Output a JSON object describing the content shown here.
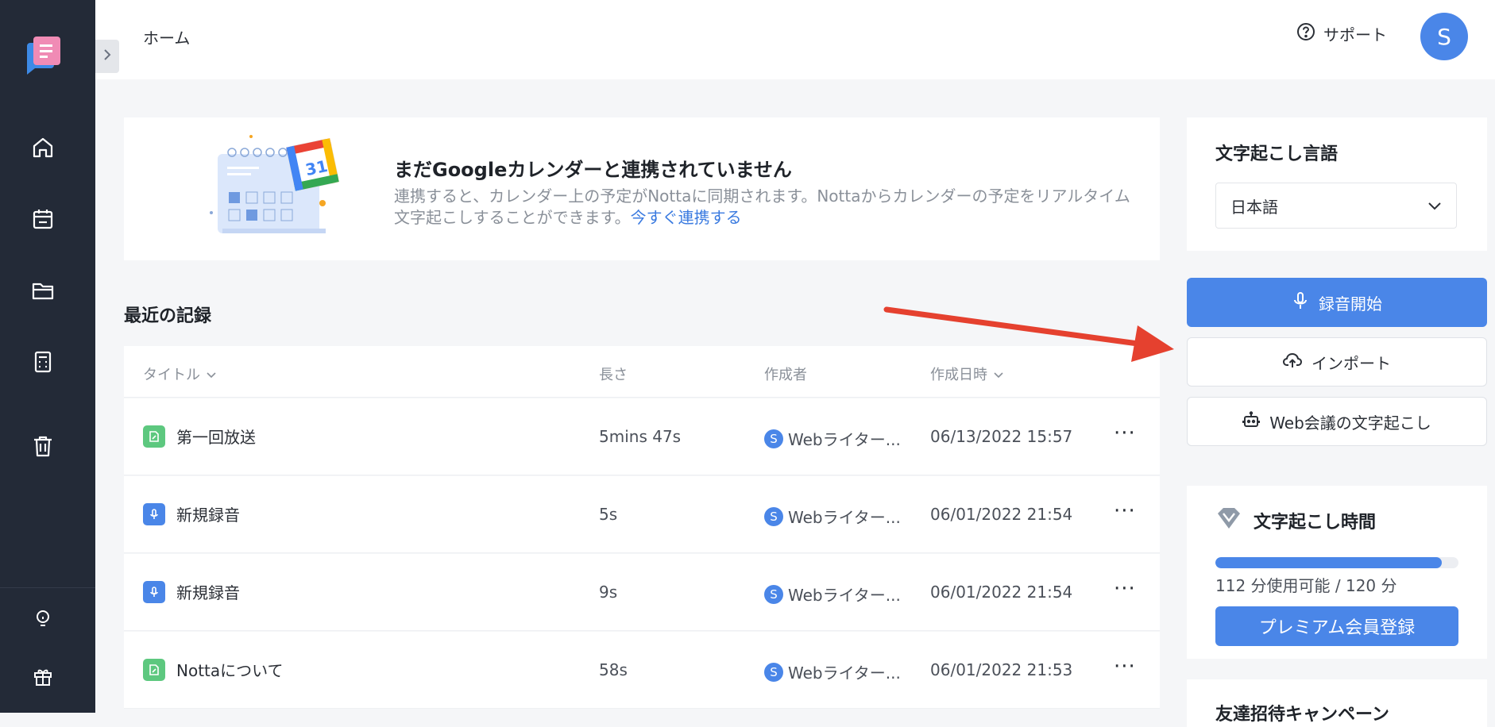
{
  "topbar": {
    "breadcrumb": "ホーム",
    "support_label": "サポート",
    "avatar_initial": "S"
  },
  "calendar_banner": {
    "calendar_day": "31",
    "title": "まだGoogleカレンダーと連携されていません",
    "description": "連携すると、カレンダー上の予定がNottaに同期されます。Nottaからカレンダーの予定をリアルタイム文字起こしすることができます。",
    "link_label": "今すぐ連携する"
  },
  "recent": {
    "section_title": "最近の記録",
    "columns": {
      "title": "タイトル",
      "length": "長さ",
      "creator": "作成者",
      "created_at": "作成日時"
    },
    "rows": [
      {
        "title": "第一回放送",
        "icon": "document-icon",
        "length": "5mins 47s",
        "creator_initial": "S",
        "creator": "Webライター...",
        "date": "06/13/2022 15:57",
        "more": "···"
      },
      {
        "title": "新規録音",
        "icon": "microphone-icon",
        "length": "5s",
        "creator_initial": "S",
        "creator": "Webライター...",
        "date": "06/01/2022 21:54",
        "more": "···"
      },
      {
        "title": "新規録音",
        "icon": "microphone-icon",
        "length": "9s",
        "creator_initial": "S",
        "creator": "Webライター...",
        "date": "06/01/2022 21:54",
        "more": "···"
      },
      {
        "title": "Nottaについて",
        "icon": "document-icon",
        "length": "58s",
        "creator_initial": "S",
        "creator": "Webライター...",
        "date": "06/01/2022 21:53",
        "more": "···"
      }
    ]
  },
  "language": {
    "label": "文字起こし言語",
    "selected": "日本語"
  },
  "actions": {
    "record_label": "録音開始",
    "import_label": "インポート",
    "web_meeting_label": "Web会議の文字起こし"
  },
  "transcription_time": {
    "title": "文字起こし時間",
    "usage_text": "112 分使用可能 / 120 分",
    "used_fraction": 0.933,
    "premium_label": "プレミアム会員登録"
  },
  "invite": {
    "title": "友達招待キャンペーン"
  },
  "colors": {
    "accent": "#4a86e8",
    "sidebar": "#232a37",
    "annotation_arrow": "#e5412f"
  }
}
